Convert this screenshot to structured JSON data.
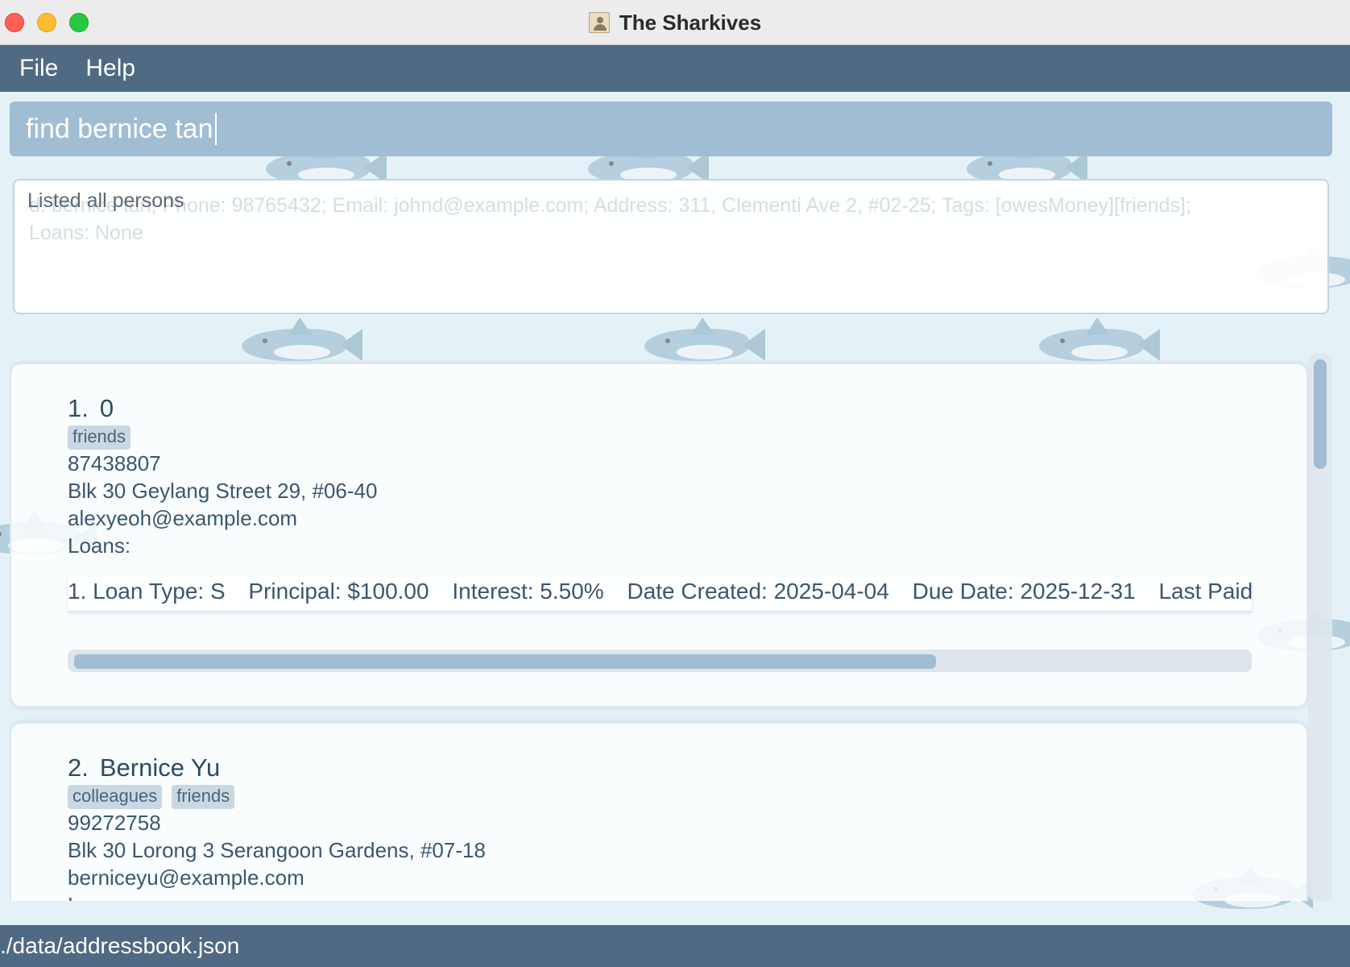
{
  "window": {
    "title": "The Sharkives"
  },
  "menu": {
    "file": "File",
    "help": "Help"
  },
  "command": {
    "value": "find bernice tan"
  },
  "result": {
    "message": "Listed all persons",
    "ghost_text": "d: bernice tan; Phone: 98765432; Email: johnd@example.com; Address: 311, Clementi Ave 2, #02-25; Tags: [owesMoney][friends]; Loans: None"
  },
  "persons": [
    {
      "index": "1.",
      "name": "0",
      "tags": [
        "friends"
      ],
      "phone": "87438807",
      "address": "Blk 30 Geylang Street 29, #06-40",
      "email": "alexyeoh@example.com",
      "loans_label": "Loans:",
      "loan": {
        "prefix": "1. Loan Type: S",
        "principal": "Principal: $100.00",
        "interest": "Interest: 5.50%",
        "created": "Date Created: 2025-04-04",
        "due": "Due Date: 2025-12-31",
        "last_paid": "Last Paid: No"
      }
    },
    {
      "index": "2.",
      "name": "Bernice Yu",
      "tags": [
        "colleagues",
        "friends"
      ],
      "phone": "99272758",
      "address": "Blk 30 Lorong 3 Serangoon Gardens, #07-18",
      "email": "berniceyu@example.com",
      "loans_label": "Loans:"
    }
  ],
  "status": {
    "path": "./data/addressbook.json"
  },
  "colors": {
    "bar": "#4f6a82",
    "command_bg": "#a1bdd4",
    "tag_bg": "#c9d8e3",
    "text": "#3a5770"
  }
}
